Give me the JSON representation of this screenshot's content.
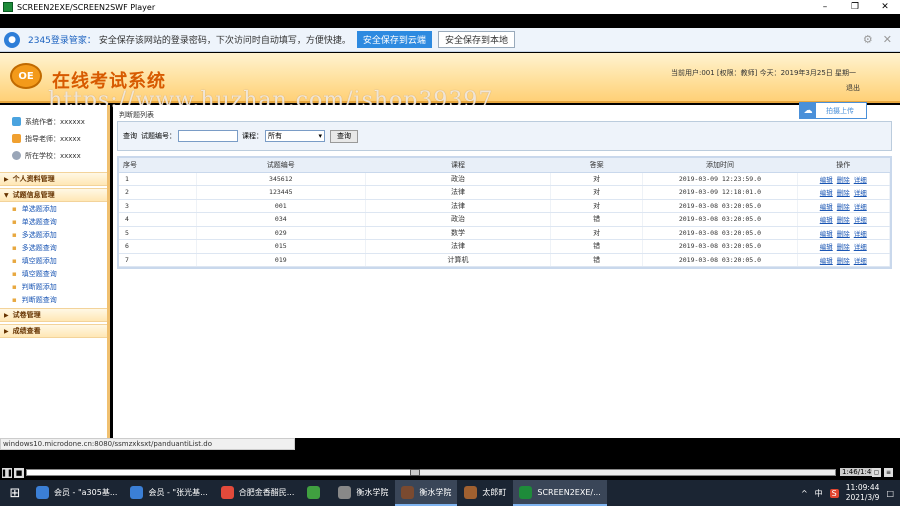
{
  "window": {
    "title": "SCREEN2EXE/SCREEN2SWF Player",
    "controls": [
      "–",
      "❐",
      "✕"
    ]
  },
  "password_bar": {
    "brand": "2345登录管家：",
    "message": "安全保存该网站的登录密码，下次访问时自动填写，方便快捷。",
    "btn_cloud": "安全保存到云端",
    "btn_local": "安全保存到本地"
  },
  "header": {
    "logo_text": "OE",
    "title": "在线考试系统",
    "user_info": "当前用户:001 [权限：教师] 今天：2019年3月25日 星期一",
    "logout": "退出"
  },
  "watermark": "https://www.huzhan.com/ishop39397",
  "sidebar": {
    "info": [
      {
        "label": "系统作者：xxxxxx",
        "icon": "user-icon",
        "color": "#4aa3df"
      },
      {
        "label": "指导老师：xxxxx",
        "icon": "teacher-icon",
        "color": "#f0a030"
      },
      {
        "label": "所在学校：xxxxx",
        "icon": "school-icon",
        "color": "#9aa6b8"
      }
    ],
    "menus": [
      {
        "label": "个人资料管理",
        "items": []
      },
      {
        "label": "试题信息管理",
        "items": [
          "单选题添加",
          "单选题查询",
          "多选题添加",
          "多选题查询",
          "填空题添加",
          "填空题查询",
          "判断题添加",
          "判断题查询"
        ]
      },
      {
        "label": "试卷管理",
        "items": []
      },
      {
        "label": "成绩查看",
        "items": []
      }
    ]
  },
  "main": {
    "share_btn": "拍摄上传",
    "panel_title": "判断题列表",
    "search": {
      "query_label": "查询",
      "id_label": "试题编号：",
      "id_value": "",
      "course_label": "课程：",
      "course_value": "所有",
      "button": "查询"
    },
    "table": {
      "headers": [
        "序号",
        "试题编号",
        "课程",
        "答案",
        "添加时间",
        "操作"
      ],
      "ops": [
        "编辑",
        "删除",
        "详细"
      ],
      "rows": [
        [
          "1",
          "345612",
          "政治",
          "对",
          "2019-03-09 12:23:59.0"
        ],
        [
          "2",
          "123445",
          "法律",
          "对",
          "2019-03-09 12:18:01.0"
        ],
        [
          "3",
          "001",
          "法律",
          "对",
          "2019-03-08 03:20:05.0"
        ],
        [
          "4",
          "034",
          "政治",
          "错",
          "2019-03-08 03:20:05.0"
        ],
        [
          "5",
          "029",
          "数学",
          "对",
          "2019-03-08 03:20:05.0"
        ],
        [
          "6",
          "015",
          "法律",
          "错",
          "2019-03-08 03:20:05.0"
        ],
        [
          "7",
          "019",
          "计算机",
          "错",
          "2019-03-08 03:20:05.0"
        ]
      ]
    }
  },
  "status_url": "windows10.microdone.cn:8080/ssmzxksxt/panduantiList.do",
  "player": {
    "time": "1:46/1:49",
    "progress": 0.48
  },
  "taskbar": {
    "tasks": [
      {
        "label": "会员 - \"a305基...",
        "color": "#3b7fd6",
        "active": false
      },
      {
        "label": "会员 - \"张光基...",
        "color": "#3b7fd6",
        "active": false
      },
      {
        "label": "合肥金香醋民...",
        "color": "#e24a3b",
        "active": false
      },
      {
        "label": "",
        "color": "#40a040",
        "active": false
      },
      {
        "label": "衡水学院",
        "color": "#888888",
        "active": false
      },
      {
        "label": "衡水学院",
        "color": "#7a4a30",
        "active": true
      },
      {
        "label": "太郎町",
        "color": "#a06030",
        "active": false
      },
      {
        "label": "SCREEN2EXE/...",
        "color": "#1e8b3a",
        "active": true
      }
    ],
    "tray": [
      "^",
      "中",
      "S"
    ],
    "time": "11:09:44",
    "date": "2021/3/9"
  }
}
